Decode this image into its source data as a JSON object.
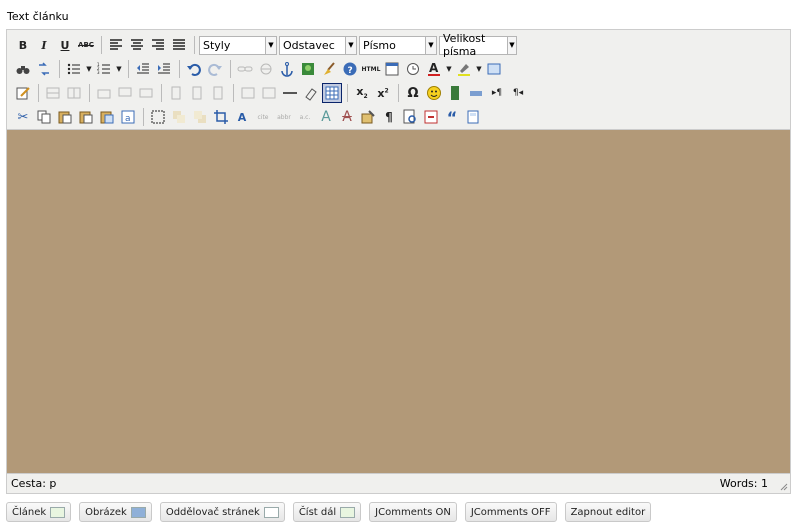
{
  "field_label": "Text článku",
  "toolbar": {
    "styles_select": "Styly",
    "paragraph_select": "Odstavec",
    "font_select": "Písmo",
    "size_select": "Velikost písma",
    "bold": "B",
    "italic": "I",
    "underline": "U",
    "strike": "ABC",
    "html_label": "HTML",
    "special_char": "Ω",
    "pilcrow": "¶",
    "quote": "“",
    "text_color_letter": "A"
  },
  "status_bar": {
    "path": "Cesta: p",
    "words": "Words: 1"
  },
  "colors": {
    "content_bg": "#b29978",
    "toolbar_bg": "#f0f0ee"
  },
  "buttons": [
    {
      "label": "Článek"
    },
    {
      "label": "Obrázek"
    },
    {
      "label": "Oddělovač stránek"
    },
    {
      "label": "Číst dál"
    },
    {
      "label": "JComments ON"
    },
    {
      "label": "JComments OFF"
    },
    {
      "label": "Zapnout editor"
    }
  ]
}
